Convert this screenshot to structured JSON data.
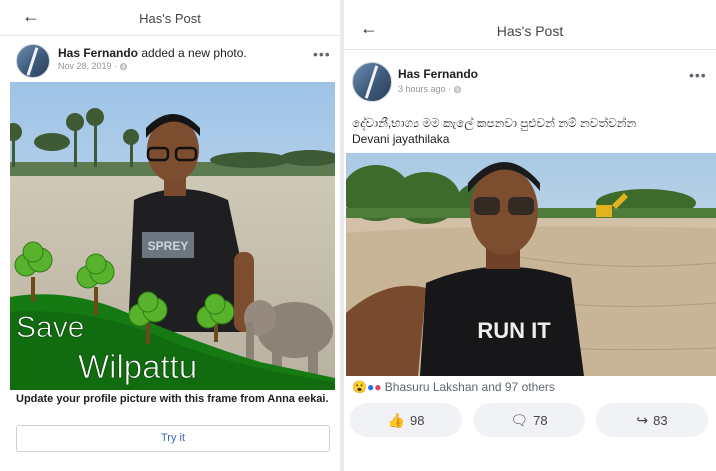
{
  "left": {
    "header": {
      "back_icon": "←",
      "title": "Has's Post"
    },
    "post": {
      "author": "Has Fernando",
      "action": " added a new photo.",
      "date": "Nov 28, 2019 · ",
      "more": "•••",
      "frame_text_1": "Save",
      "frame_text_2": "Wilpattu",
      "tshirt_text": "SPREY",
      "caption": "Update your profile picture with this frame from Anna eekai.",
      "cta": "Try it"
    }
  },
  "right": {
    "header": {
      "back_icon": "←",
      "title": "Has's Post"
    },
    "post": {
      "author": "Has Fernando",
      "time": "3 hours ago · ",
      "more": "•••",
      "text_line1": "දේවානී,භාග්‍ය මම කැලේ කපනවා පුළුවන් නම් නවත්වන්න",
      "text_line2": "Devani jayathilaka",
      "tshirt_text": "RUN IT",
      "reactions": "Bhasuru Lakshan and 97 others",
      "buttons": [
        {
          "icon": "thumbs-up-icon",
          "count": "98"
        },
        {
          "icon": "comment-icon",
          "count": "78"
        },
        {
          "icon": "share-icon",
          "count": "83"
        }
      ]
    }
  }
}
